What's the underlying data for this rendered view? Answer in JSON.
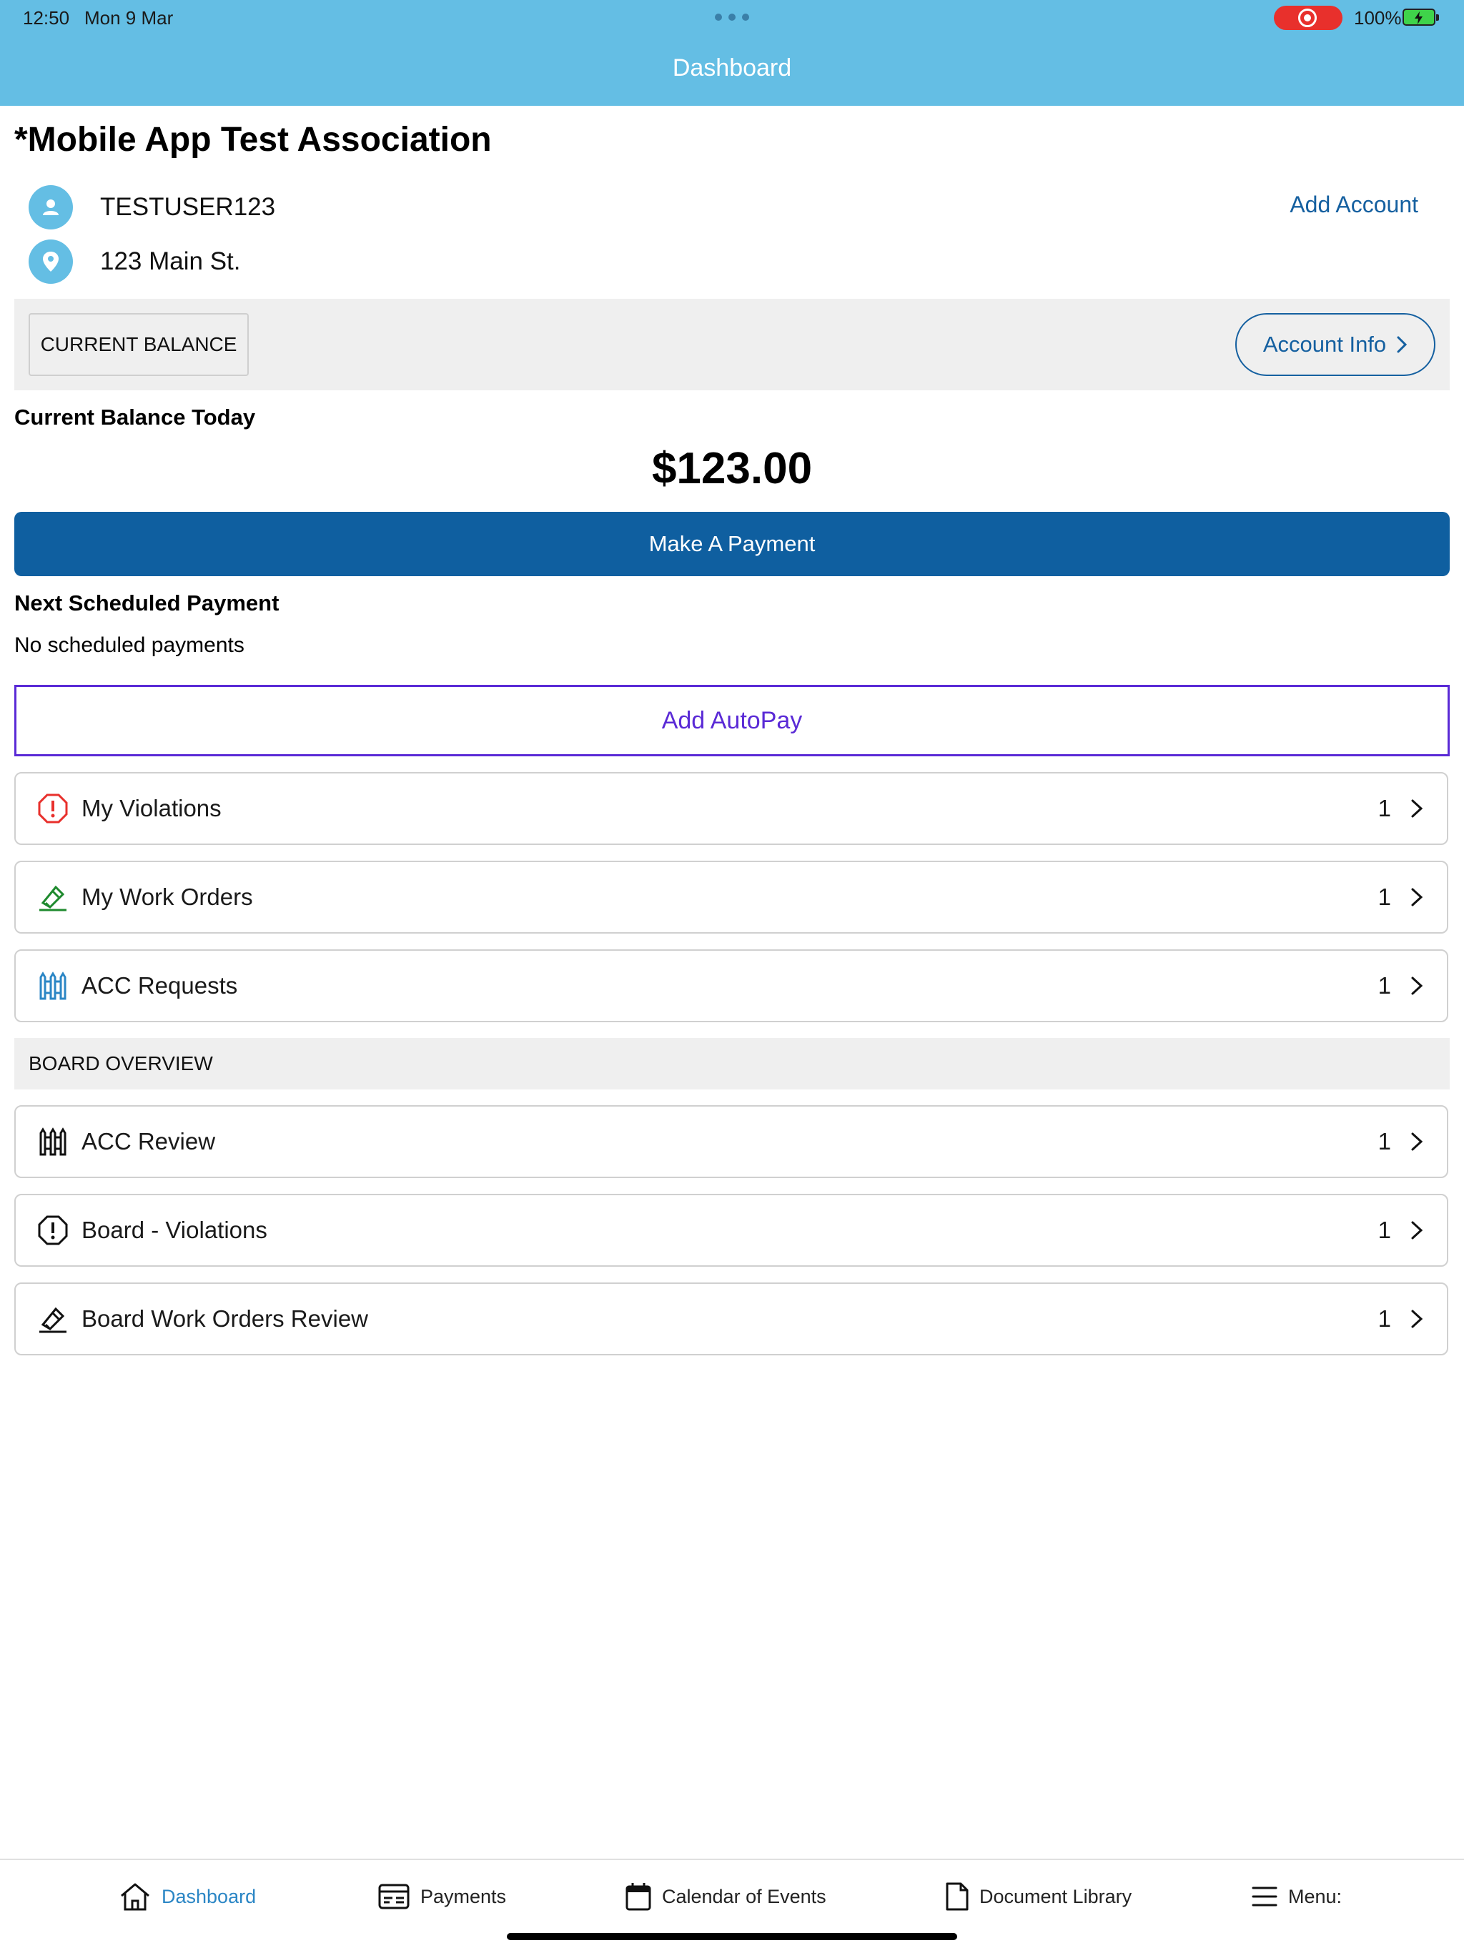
{
  "status_bar": {
    "time": "12:50",
    "date": "Mon 9 Mar",
    "battery": "100%"
  },
  "nav": {
    "title": "Dashboard"
  },
  "association": {
    "name": "*Mobile App Test Association"
  },
  "account": {
    "user": "TESTUSER123",
    "address": "123 Main St.",
    "add_account": "Add Account"
  },
  "balance": {
    "tag": "CURRENT BALANCE",
    "account_info": "Account Info",
    "today_label": "Current Balance Today",
    "amount": "$123.00",
    "make_payment": "Make A Payment"
  },
  "scheduled": {
    "label": "Next Scheduled Payment",
    "value": "No scheduled payments",
    "autopay": "Add AutoPay"
  },
  "items": [
    {
      "label": "My Violations",
      "count": "1",
      "icon": "violation-icon",
      "color": "#e8302c"
    },
    {
      "label": "My Work Orders",
      "count": "1",
      "icon": "work-order-icon",
      "color": "#1e8a2e"
    },
    {
      "label": "ACC Requests",
      "count": "1",
      "icon": "fence-icon",
      "color": "#2b86c5"
    }
  ],
  "board": {
    "title": "BOARD OVERVIEW",
    "items": [
      {
        "label": "ACC Review",
        "count": "1",
        "icon": "fence-icon",
        "color": "#111111"
      },
      {
        "label": "Board - Violations",
        "count": "1",
        "icon": "violation-icon",
        "color": "#111111"
      },
      {
        "label": "Board Work Orders Review",
        "count": "1",
        "icon": "work-order-icon",
        "color": "#111111"
      }
    ]
  },
  "tabs": [
    {
      "label": "Dashboard",
      "icon": "home-icon",
      "active": true
    },
    {
      "label": "Payments",
      "icon": "payments-icon"
    },
    {
      "label": "Calendar of Events",
      "icon": "calendar-icon"
    },
    {
      "label": "Document Library",
      "icon": "document-icon"
    },
    {
      "label": "Menu:",
      "icon": "menu-icon"
    }
  ],
  "colors": {
    "header": "#64bee4",
    "primary": "#0f5fa0",
    "link": "#1560a0",
    "autopay": "#5a2ad6",
    "active_tab": "#2b86c5"
  }
}
